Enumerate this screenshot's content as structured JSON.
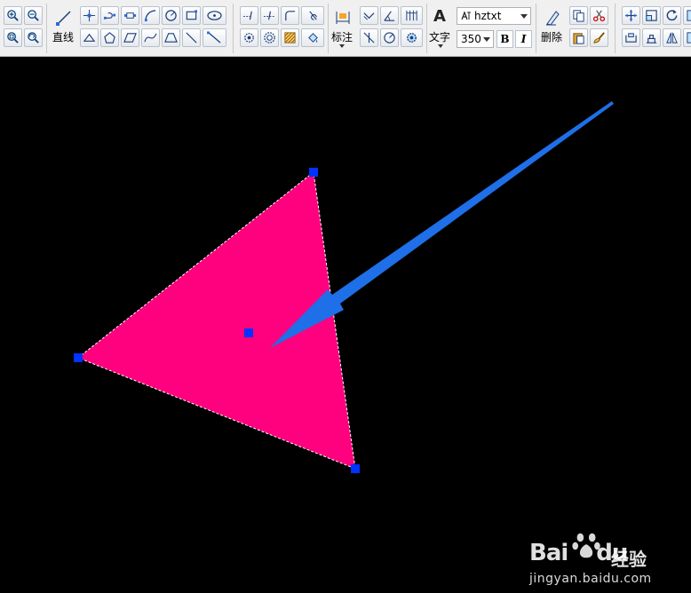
{
  "toolbar": {
    "line_label": "直线",
    "annotate_label": "标注",
    "text_label": "文字",
    "delete_label": "删除",
    "font_name": "hztxt",
    "font_size": "350",
    "bold_label": "B",
    "italic_label": "I",
    "text_glyph": "A"
  },
  "drawing": {
    "shape": "triangle",
    "fill_color": "#ff007f",
    "grip_color": "#0033ff",
    "arrow_color": "#1e6fe8"
  },
  "watermark": {
    "brand_pre": "Bai",
    "brand_post": "du",
    "brand_cn": "经验",
    "url": "jingyan.baidu.com"
  }
}
